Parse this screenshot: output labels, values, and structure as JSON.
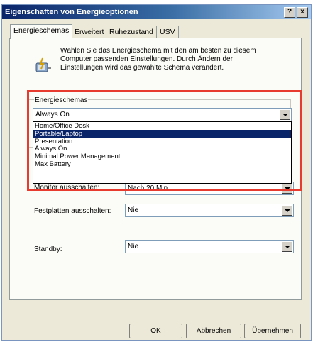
{
  "window": {
    "title": "Eigenschaften von Energieoptionen"
  },
  "titlebar_buttons": {
    "help": "?",
    "close": "x"
  },
  "tabs": [
    {
      "label": "Energieschemas"
    },
    {
      "label": "Erweitert"
    },
    {
      "label": "Ruhezustand"
    },
    {
      "label": "USV"
    }
  ],
  "description": "Wählen Sie das Energieschema mit den am besten zu diesem Computer passenden Einstellungen. Durch Ändern der Einstellungen wird das gewählte Schema verändert.",
  "scheme_group": {
    "label": "Energieschemas",
    "selected": "Always On",
    "options": [
      "Home/Office Desk",
      "Portable/Laptop",
      "Presentation",
      "Always On",
      "Minimal Power Management",
      "Max Battery"
    ],
    "highlighted_option": "Portable/Laptop"
  },
  "settings": {
    "monitor": {
      "label": "Monitor ausschalten:",
      "value": "Nach 20 Min."
    },
    "disks": {
      "label": "Festplatten ausschalten:",
      "value": "Nie"
    },
    "standby": {
      "label": "Standby:",
      "value": "Nie"
    }
  },
  "buttons": {
    "ok": "OK",
    "cancel": "Abbrechen",
    "apply": "Übernehmen"
  },
  "colors": {
    "highlight_frame": "#e63b2e",
    "selection": "#0a246a"
  }
}
